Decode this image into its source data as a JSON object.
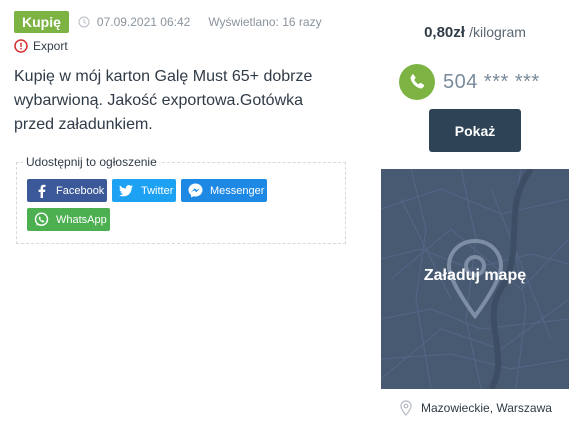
{
  "listing": {
    "type_badge": "Kupię",
    "date": "07.09.2021 06:42",
    "views": "Wyświetlano: 16 razy",
    "tag": "Export",
    "description": "Kupię w mój karton Galę Must 65+ dobrze wybarwioną. Jakość exportowa.Gotówka przed załadunkiem."
  },
  "share": {
    "title": "Udostępnij to ogłoszenie",
    "buttons": {
      "facebook": "Facebook",
      "twitter": "Twitter",
      "messenger": "Messenger",
      "whatsapp": "WhatsApp"
    }
  },
  "sidebar": {
    "price": "0,80zł",
    "unit": "/kilogram",
    "phone": "504 *** ***",
    "show_button": "Pokaż",
    "map_label": "Załaduj mapę",
    "location": "Mazowieckie, Warszawa"
  },
  "colors": {
    "badge_green": "#7cb342",
    "show_button_bg": "#2f4357",
    "map_bg": "#485a72",
    "facebook": "#3b5998",
    "twitter": "#1da1f2",
    "messenger": "#1e88e5",
    "whatsapp": "#4caf50"
  },
  "icons": [
    "clock-icon",
    "alert-circle-icon",
    "facebook-icon",
    "twitter-icon",
    "messenger-icon",
    "whatsapp-icon",
    "phone-icon",
    "map-pin-icon",
    "location-pin-icon"
  ]
}
